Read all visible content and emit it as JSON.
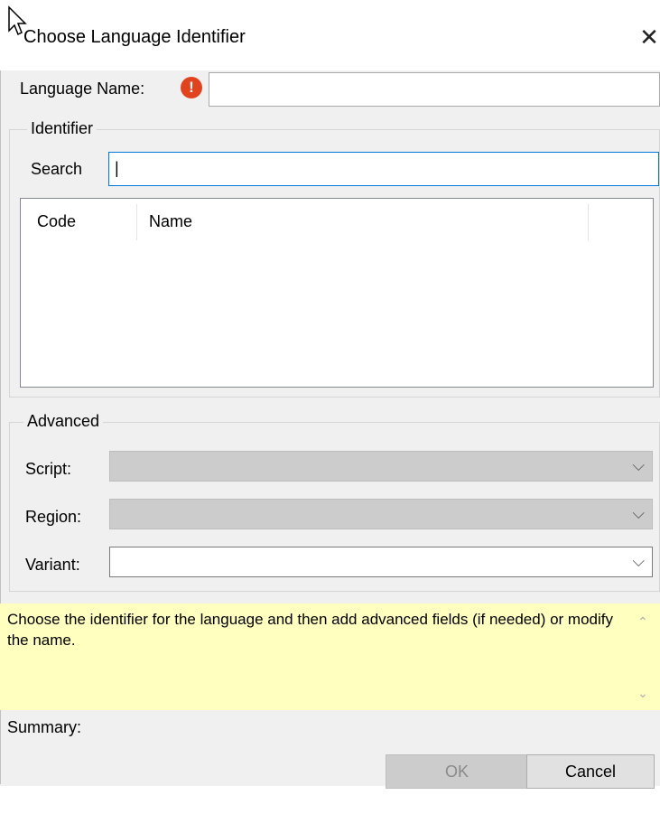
{
  "window": {
    "title": "Choose Language Identifier",
    "close_glyph": "✕"
  },
  "language_name": {
    "label": "Language Name:",
    "value": "",
    "error_glyph": "!"
  },
  "identifier": {
    "legend": "Identifier",
    "search_label": "Search",
    "search_value": "|",
    "columns": [
      "Code",
      "Name"
    ]
  },
  "advanced": {
    "legend": "Advanced",
    "script_label": "Script:",
    "region_label": "Region:",
    "variant_label": "Variant:",
    "chevron": "⌵"
  },
  "info": {
    "text": "Choose the identifier for the language and then add advanced fields (if needed) or modify the name.",
    "scroll_up": "⌃",
    "scroll_down": "⌄"
  },
  "summary_label": "Summary:",
  "buttons": {
    "ok": "OK",
    "cancel": "Cancel"
  },
  "colors": {
    "error": "#e0431e",
    "info_bg": "#ffffc0",
    "focus_border": "#0078d7"
  },
  "icons": {
    "cursor": "arrow-cursor-icon",
    "close": "close-icon",
    "error": "error-icon",
    "dropdown": "chevron-down-icon"
  }
}
